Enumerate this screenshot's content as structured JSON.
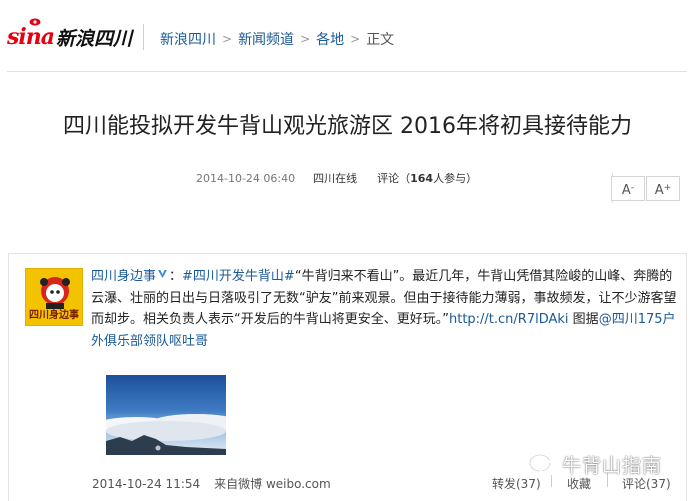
{
  "header": {
    "logo_latin": "sina",
    "logo_cn": "新浪四川",
    "breadcrumb": [
      "新浪四川",
      "新闻频道",
      "各地",
      "正文"
    ],
    "breadcrumb_sep": ">"
  },
  "article": {
    "title": "四川能投拟开发牛背山观光旅游区 2016年将初具接待能力",
    "time": "2014-10-24 06:40",
    "source": "四川在线",
    "comment_prefix": "评论（",
    "comment_count": "164",
    "comment_suffix": "人参与）",
    "font_smaller": "A",
    "font_smaller_sup": "-",
    "font_larger": "A",
    "font_larger_sup": "+"
  },
  "weibo": {
    "avatar_label": "四川身边事",
    "user": "四川身边事",
    "colon": "：",
    "topic": "#四川开发牛背山#",
    "text": "“牛背归来不看山”。最近几年，牛背山凭借其险峻的山峰、奔腾的云瀑、壮丽的日出与日落吸引了无数“驴友”前来观景。但由于接待能力薄弱，事故频发，让不少游客望而却步。相关负责人表示“开发后的牛背山将更安全、更好玩。”",
    "link": "http://t.cn/R7lDAki",
    "photo_credit_prefix": " 图据",
    "photo_credit": "@四川175户外俱乐部领队呕吐哥",
    "time": "2014-10-24 11:54",
    "via": "来自微博 weibo.com",
    "repost": "转发(37)",
    "favorite": "收藏",
    "comment": "评论(37)"
  },
  "watermark": {
    "text": "牛背山指南",
    "icon": "wechat-icon"
  },
  "colors": {
    "brand_red": "#e60012",
    "link_blue": "#1a5a99",
    "avatar_yellow": "#f3c300"
  }
}
